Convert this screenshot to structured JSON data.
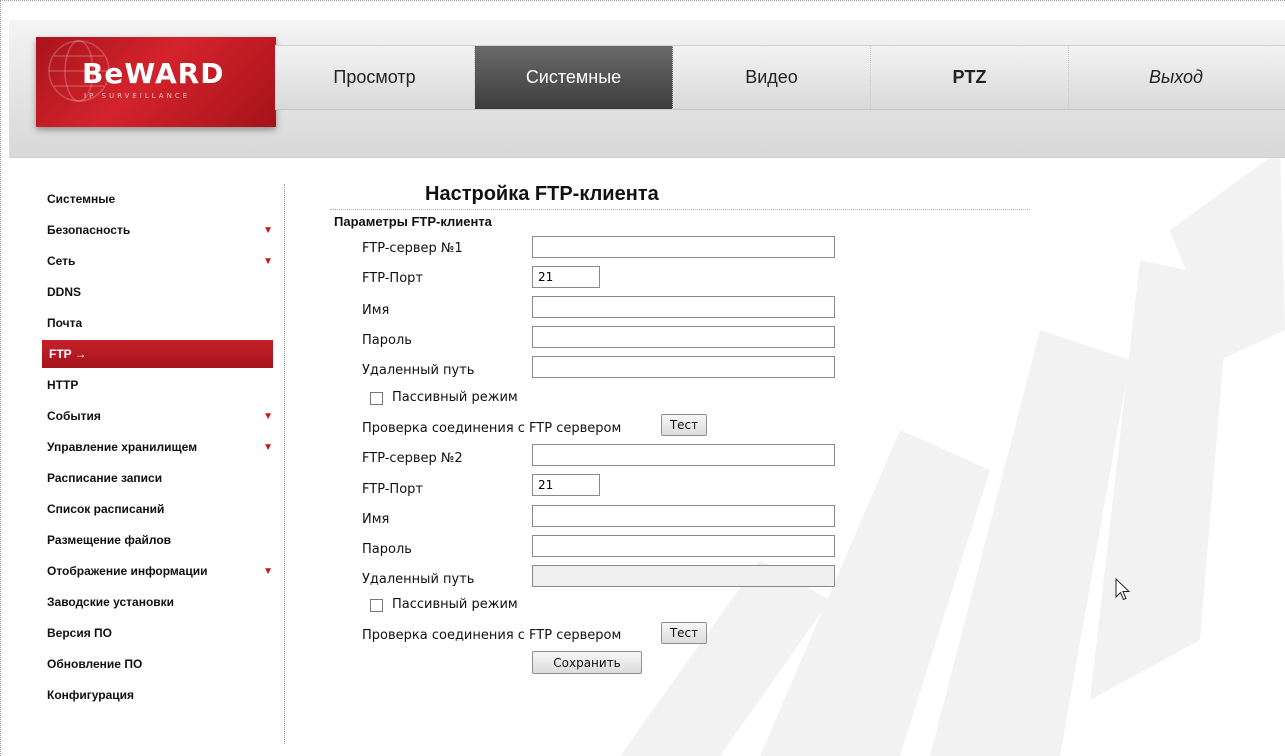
{
  "header": {
    "logo_text": "BeWARD",
    "logo_subtitle": "IP SURVEILLANCE",
    "tabs": [
      {
        "label": "Просмотр"
      },
      {
        "label": "Системные"
      },
      {
        "label": "Видео"
      },
      {
        "label": "PTZ"
      },
      {
        "label": "Выход"
      }
    ]
  },
  "sidebar": {
    "items": [
      {
        "label": "Системные"
      },
      {
        "label": "Безопасность"
      },
      {
        "label": "Сеть"
      },
      {
        "label": "DDNS"
      },
      {
        "label": "Почта"
      },
      {
        "label": "FTP",
        "arrow": "→"
      },
      {
        "label": "HTTP"
      },
      {
        "label": "События"
      },
      {
        "label": "Управление хранилищем"
      },
      {
        "label": "Расписание записи"
      },
      {
        "label": "Список расписаний"
      },
      {
        "label": "Размещение файлов"
      },
      {
        "label": "Отображение информации"
      },
      {
        "label": "Заводские установки"
      },
      {
        "label": "Версия ПО"
      },
      {
        "label": "Обновление ПО"
      },
      {
        "label": "Конфигурация"
      }
    ],
    "expand_icon": "triangle-down-icon"
  },
  "main": {
    "title": "Настройка FTP-клиента",
    "section": "Параметры FTP-клиента",
    "server1": {
      "server_label": "FTP-сервер №1",
      "server_value": "",
      "port_label": "FTP-Порт",
      "port_value": "21",
      "name_label": "Имя",
      "name_value": "",
      "password_label": "Пароль",
      "password_value": "",
      "path_label": "Удаленный путь",
      "path_value": "",
      "passive_label": "Пассивный режим",
      "passive_checked": false,
      "test_label": "Проверка соединения с FTP сервером",
      "test_button": "Тест"
    },
    "server2": {
      "server_label": "FTP-сервер №2",
      "server_value": "",
      "port_label": "FTP-Порт",
      "port_value": "21",
      "name_label": "Имя",
      "name_value": "",
      "password_label": "Пароль",
      "password_value": "",
      "path_label": "Удаленный путь",
      "path_value": "",
      "passive_label": "Пассивный режим",
      "passive_checked": false,
      "test_label": "Проверка соединения с FTP сервером",
      "test_button": "Тест"
    },
    "save_button": "Сохранить"
  },
  "colors": {
    "brand_red": "#c8202a",
    "active_tab": "#4a4a4a"
  }
}
